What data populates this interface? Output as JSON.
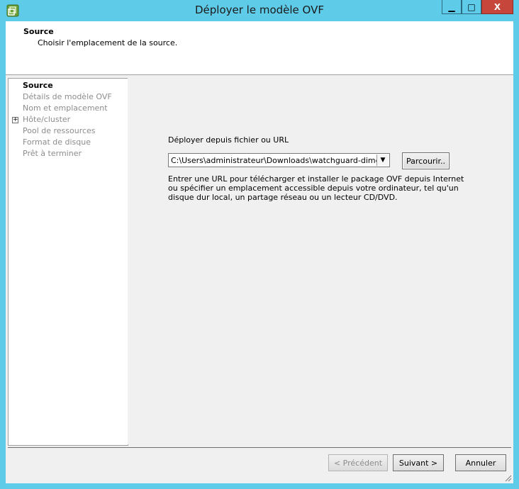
{
  "window": {
    "title": "Déployer le modèle OVF",
    "minimize_glyph": "▁",
    "maximize_glyph": "□",
    "close_glyph": "X"
  },
  "header": {
    "title": "Source",
    "subtitle": "Choisir l'emplacement de la source."
  },
  "steps": [
    {
      "label": "Source",
      "active": true
    },
    {
      "label": "Détails de modèle OVF",
      "active": false
    },
    {
      "label": "Nom et emplacement",
      "active": false
    },
    {
      "label": "Hôte/cluster",
      "active": false
    },
    {
      "label": "Pool de ressources",
      "active": false
    },
    {
      "label": "Format de disque",
      "active": false
    },
    {
      "label": "Prêt à terminer",
      "active": false
    }
  ],
  "expander_glyph": "+",
  "main": {
    "deploy_label": "Déployer depuis fichier ou URL",
    "path_value": "C:\\Users\\administrateur\\Downloads\\watchguard-dimens",
    "combo_arrow": "▼",
    "browse_label": "Parcourir..",
    "description": "Entrer une URL pour télécharger et installer le package OVF depuis Internet ou spécifier un emplacement accessible depuis votre ordinateur, tel qu'un disque dur local, un partage réseau ou un lecteur CD/DVD."
  },
  "footer": {
    "prev_label": "< Précédent",
    "next_label": "Suivant >",
    "cancel_label": "Annuler"
  },
  "colors": {
    "window_frame": "#5ecbe8",
    "close_button": "#c7463c",
    "panel_bg": "#f0f0f0"
  }
}
